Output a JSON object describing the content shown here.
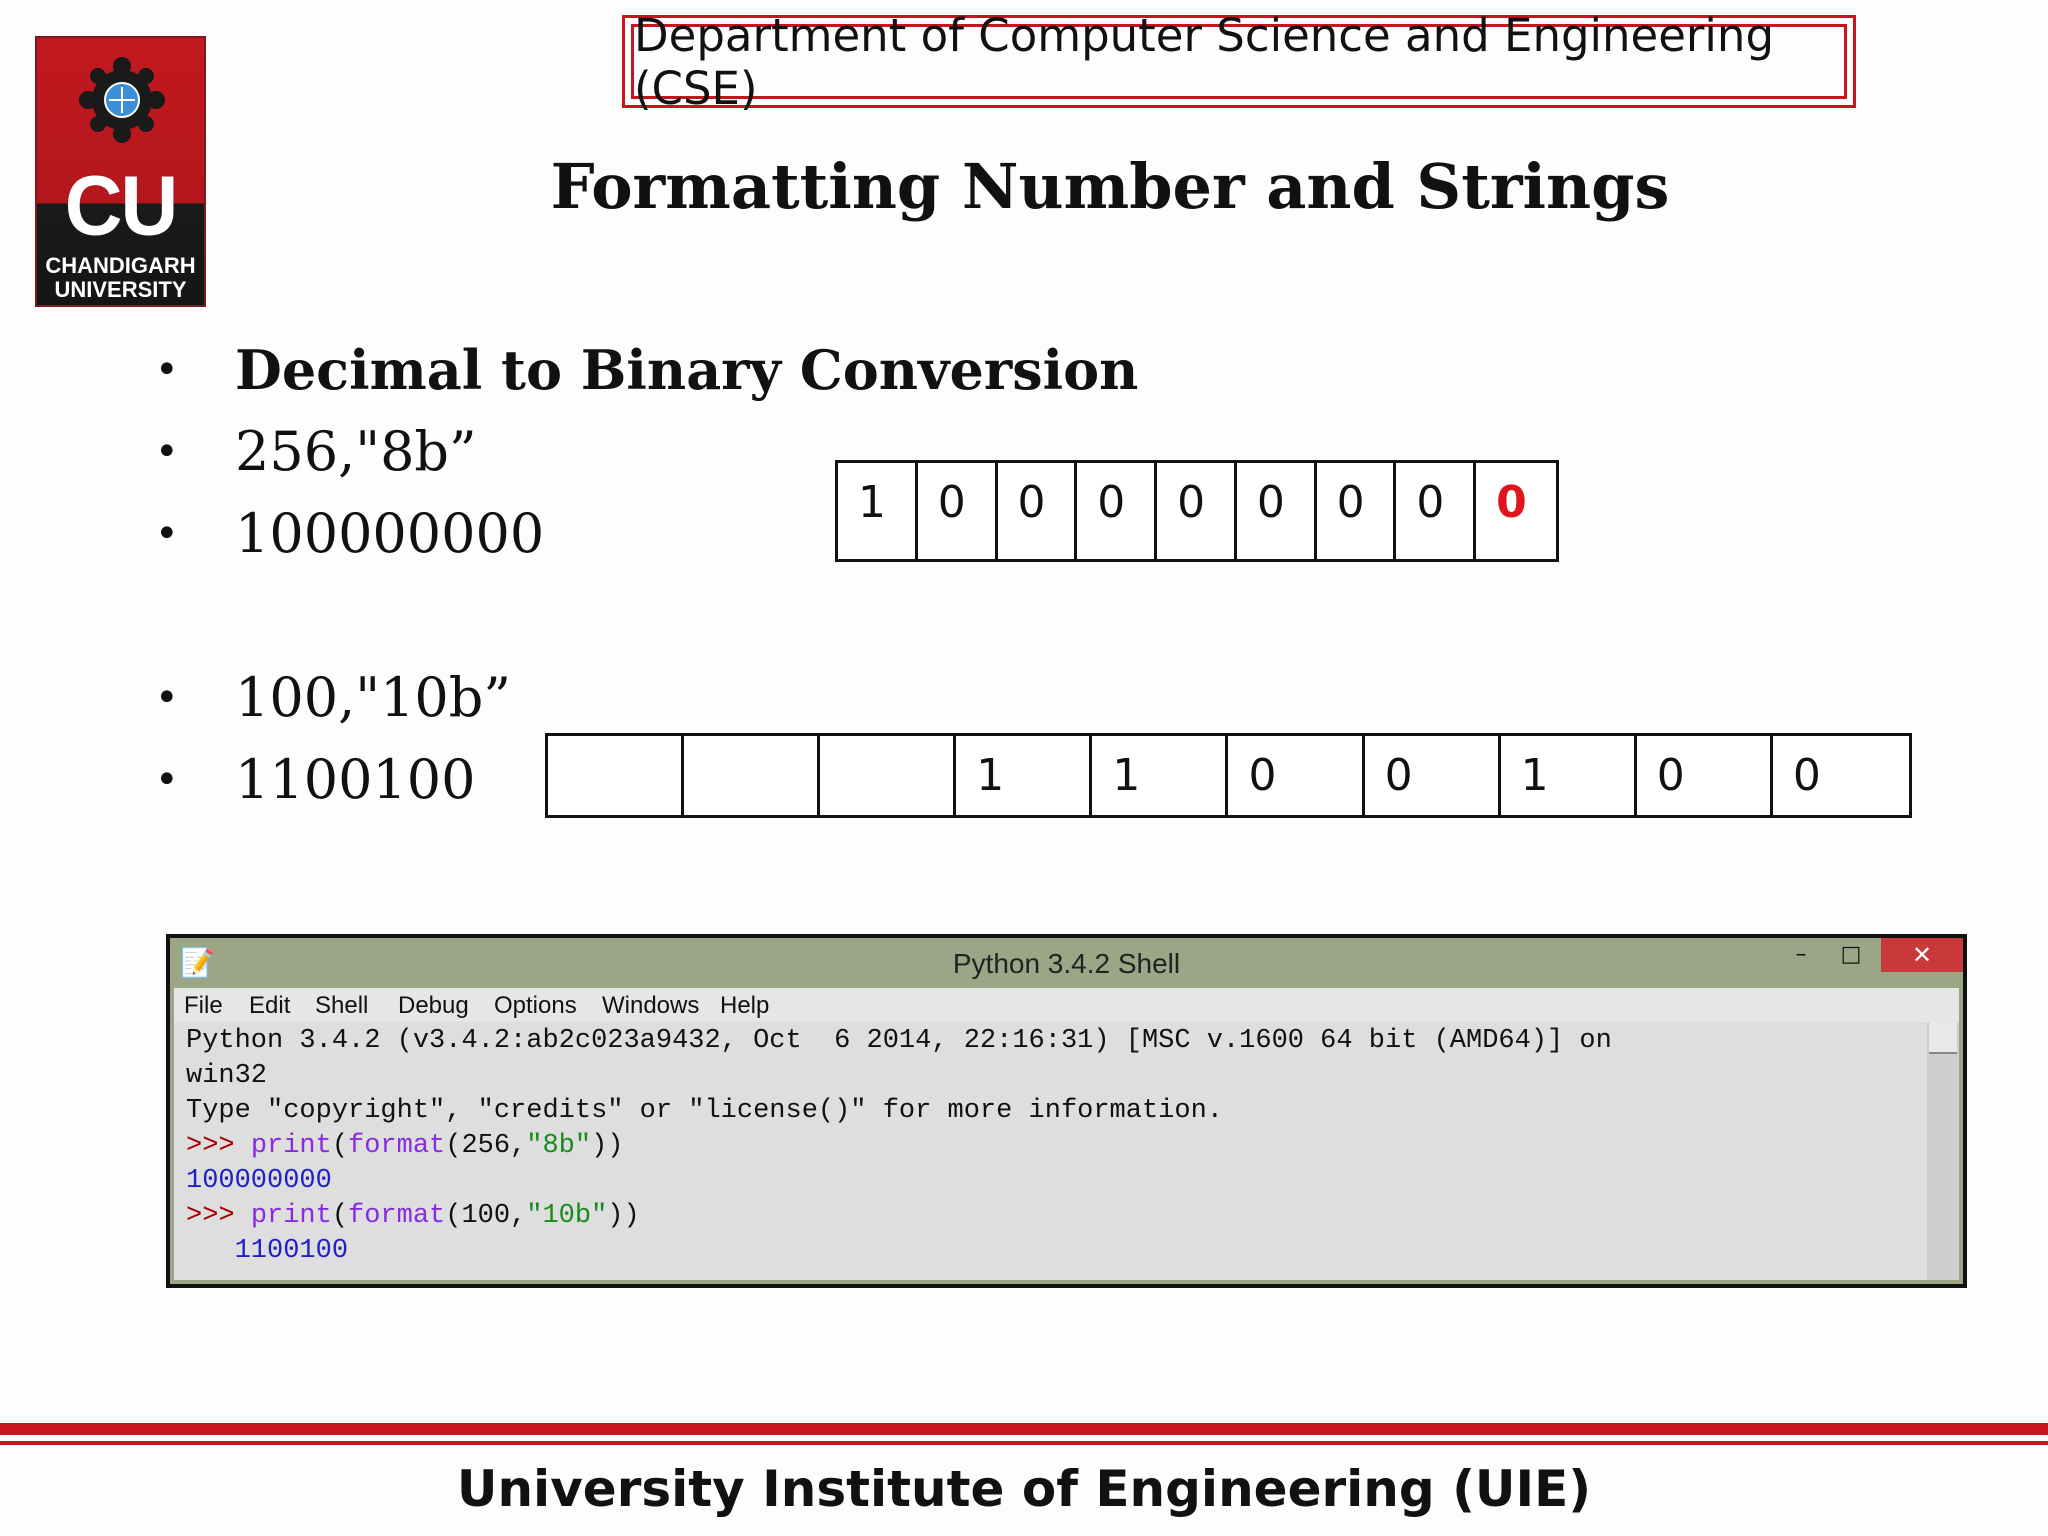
{
  "logo": {
    "short": "CU",
    "name": "CHANDIGARH\nUNIVERSITY"
  },
  "department": "Department of Computer Science and Engineering (CSE)",
  "title": "Formatting Number and Strings",
  "bullets": [
    {
      "text": "Decimal to Binary Conversion",
      "bold": true
    },
    {
      "text": "256,\"8b”",
      "bold": false
    },
    {
      "text": "100000000",
      "bold": false
    },
    {
      "text": "100,\"10b”",
      "bold": false
    },
    {
      "text": "1100100",
      "bold": false
    }
  ],
  "bullet_symbol": "•",
  "grid1": {
    "cells": [
      "1",
      "0",
      "0",
      "0",
      "0",
      "0",
      "0",
      "0",
      "0"
    ],
    "highlight_index": 8,
    "highlight_color": "#e0141c"
  },
  "grid2": {
    "cells": [
      "",
      "",
      "",
      "1",
      "1",
      "0",
      "0",
      "1",
      "0",
      "0"
    ]
  },
  "shell": {
    "title": "Python 3.4.2 Shell",
    "menu": [
      "File",
      "Edit",
      "Shell",
      "Debug",
      "Options",
      "Windows",
      "Help"
    ],
    "controls": {
      "minimize": "–",
      "maximize": "□",
      "close": "✕"
    },
    "lines": [
      {
        "type": "text",
        "text": "Python 3.4.2 (v3.4.2:ab2c023a9432, Oct  6 2014, 22:16:31) [MSC v.1600 64 bit (AMD64)] on"
      },
      {
        "type": "text",
        "text": "win32"
      },
      {
        "type": "text",
        "text": "Type \"copyright\", \"credits\" or \"license()\" for more information."
      },
      {
        "type": "cmd",
        "prompt": ">>> ",
        "fn": "print",
        "mid": "(",
        "fn2": "format",
        "args": "(256,",
        "str": "\"8b\"",
        "end": "))"
      },
      {
        "type": "out",
        "text": "100000000"
      },
      {
        "type": "cmd",
        "prompt": ">>> ",
        "fn": "print",
        "mid": "(",
        "fn2": "format",
        "args": "(100,",
        "str": "\"10b\"",
        "end": "))"
      },
      {
        "type": "out",
        "text": "   1100100"
      }
    ]
  },
  "footer": "University Institute of Engineering (UIE)",
  "colors": {
    "accent_red": "#c8141c",
    "shell_titlebar": "#9aa686"
  }
}
